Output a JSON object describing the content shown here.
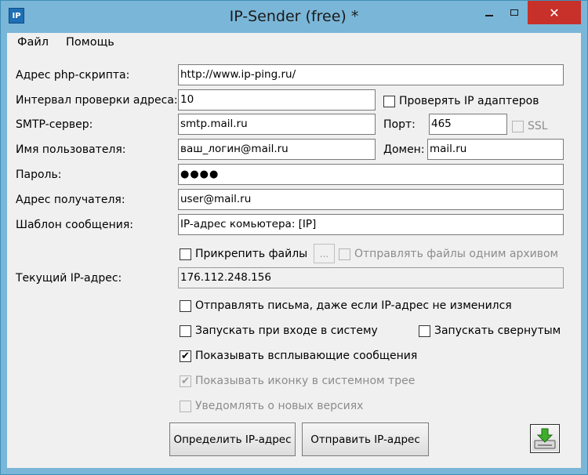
{
  "window": {
    "title": "IP-Sender (free) *",
    "icon_text": "IP"
  },
  "menu": [
    "Файл",
    "Помощь"
  ],
  "form": {
    "script_url_label": "Адрес php-скрипта:",
    "script_url_value": "http://www.ip-ping.ru/",
    "interval_label": "Интервал проверки адреса:",
    "interval_value": "10",
    "check_adapters_label": "Проверять IP адаптеров",
    "smtp_label": "SMTP-сервер:",
    "smtp_value": "smtp.mail.ru",
    "port_label": "Порт:",
    "port_value": "465",
    "ssl_label": "SSL",
    "user_label": "Имя пользователя:",
    "user_value": "ваш_логин@mail.ru",
    "domain_label": "Домен:",
    "domain_value": "mail.ru",
    "password_label": "Пароль:",
    "password_value": "●●●●",
    "recipient_label": "Адрес получателя:",
    "recipient_value": "user@mail.ru",
    "template_label": "Шаблон сообщения:",
    "template_value": "IP-адрес комьютера: [IP]",
    "attach_label": "Прикрепить файлы",
    "browse_label": "...",
    "archive_label": "Отправлять файлы одним архивом",
    "current_ip_label": "Текущий IP-адрес:",
    "current_ip_value": "176.112.248.156"
  },
  "options": {
    "send_always": "Отправлять письма, даже если IP-адрес не изменился",
    "run_at_login": "Запускать при входе в систему",
    "run_minimized": "Запускать свернутым",
    "show_popups": "Показывать всплывающие сообщения",
    "show_tray_icon": "Показывать иконку в системном трее",
    "notify_versions": "Уведомлять о новых версиях"
  },
  "buttons": {
    "detect_ip": "Определить IP-адрес",
    "send_ip": "Отправить IP-адрес"
  },
  "check_mark": "✔",
  "colors": {
    "titlebar": "#7ab6d8",
    "close": "#c7312a",
    "save_icon": "#3fae2a"
  }
}
